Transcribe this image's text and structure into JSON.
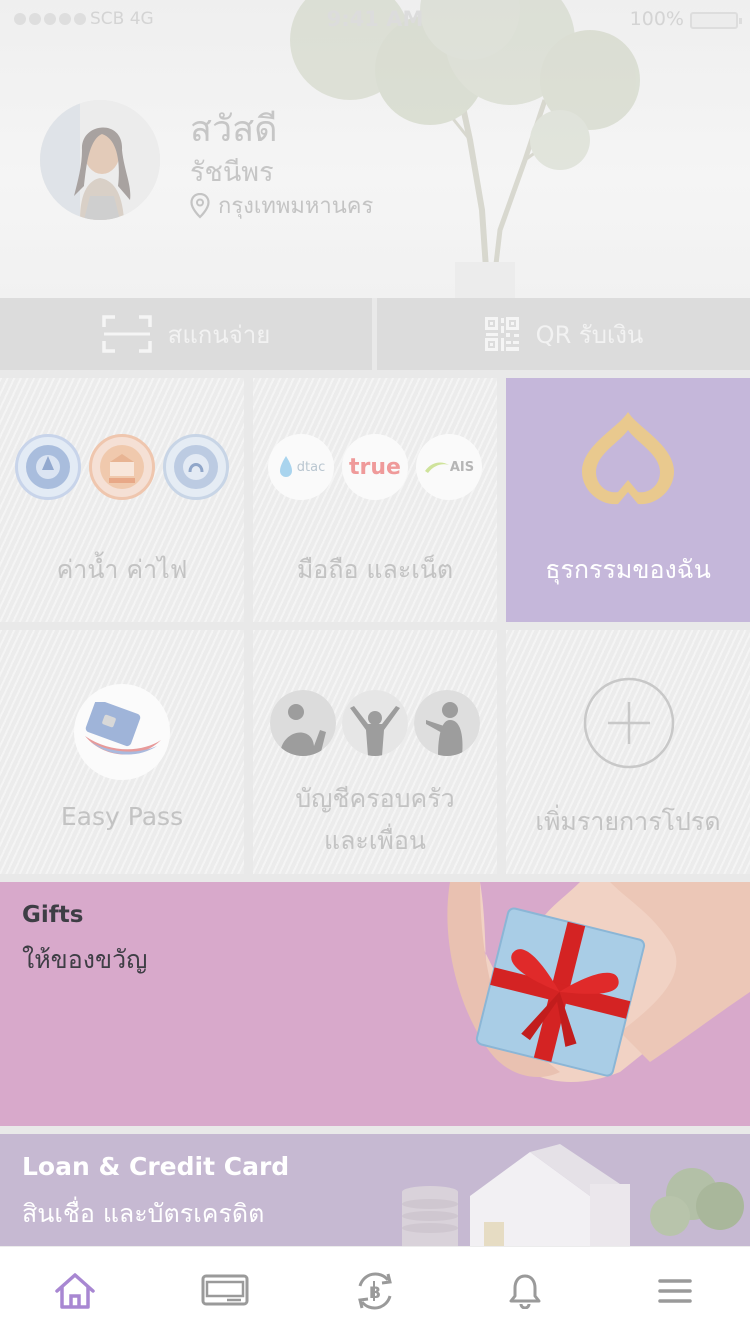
{
  "status_bar": {
    "carrier": "SCB 4G",
    "time": "9:41 AM",
    "battery": "100%"
  },
  "profile": {
    "greeting": "สวัสดี",
    "name": "รัชนีพร",
    "location": "กรุงเทพมหานคร"
  },
  "actions": {
    "scan_pay": "สแกนจ่าย",
    "qr_receive": "QR รับเงิน"
  },
  "tiles": [
    {
      "label": "ค่าน้ำ ค่าไฟ",
      "icon": "utility-logos"
    },
    {
      "label": "มือถือ และเน็ต",
      "icon": "telco-logos",
      "logos": [
        "dtac",
        "true",
        "AIS"
      ]
    },
    {
      "label": "ธุรกรรมของฉัน",
      "icon": "scb-logo-icon"
    },
    {
      "label": "Easy Pass",
      "icon": "easy-pass-icon"
    },
    {
      "label_line1": "บัญชีครอบครัว",
      "label_line2": "และเพื่อน",
      "icon": "family-friends-icon"
    },
    {
      "label": "เพิ่มรายการโปรด",
      "icon": "plus-icon"
    }
  ],
  "banners": {
    "gifts": {
      "title": "Gifts",
      "subtitle": "ให้ของขวัญ"
    },
    "loan": {
      "title": "Loan & Credit Card",
      "subtitle": "สินเชื่อ และบัตรเครดิต"
    }
  },
  "tabbar": {
    "items": [
      "home-icon",
      "card-icon",
      "transfer-baht-icon",
      "bell-icon",
      "menu-icon"
    ],
    "active": "home-icon"
  },
  "colors": {
    "accent": "#8e69c0",
    "purple_tile": "#c5b7da",
    "gifts_banner": "#d8a9cb",
    "loan_banner": "#c6b9d2"
  }
}
